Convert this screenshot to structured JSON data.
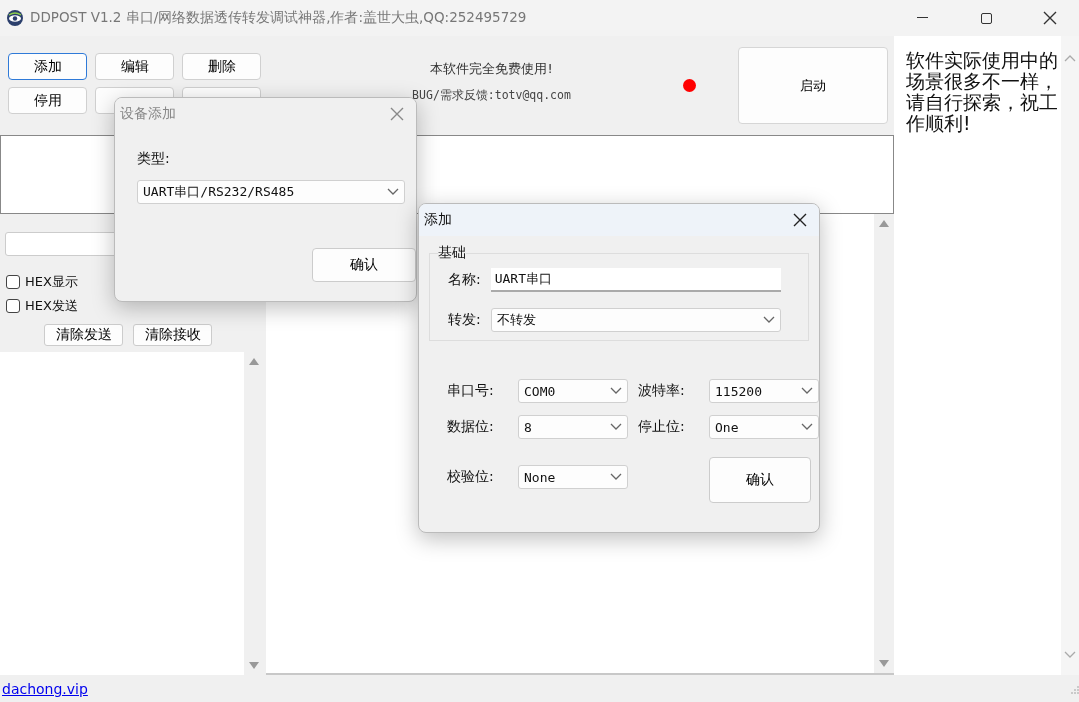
{
  "window": {
    "title": "DDPOST V1.2 串口/网络数据透传转发调试神器,作者:盖世大虫,QQ:252495729"
  },
  "toolbar": {
    "buttons": [
      {
        "label": "添加",
        "selected": true
      },
      {
        "label": "编辑",
        "selected": false
      },
      {
        "label": "删除",
        "selected": false
      },
      {
        "label": "停用",
        "selected": false
      }
    ],
    "notice": "本软件完全免费使用!",
    "feedback": "BUG/需求反馈:totv@qq.com",
    "running": false,
    "start_button": "启动"
  },
  "side_note": "软件实际使用中的场景很多不一样，请自行探索，祝工作顺利!",
  "send_panel": {
    "checkboxes": [
      {
        "label": "HEX显示",
        "checked": false
      },
      {
        "label": "HEX发送",
        "checked": false
      }
    ],
    "buttons": [
      "清除发送",
      "清除接收"
    ]
  },
  "status_bar": {
    "link": "dachong.vip"
  },
  "device_dialog": {
    "title": "设备添加",
    "active": false,
    "type_label": "类型:",
    "type_value": "UART串口/RS232/RS485",
    "confirm": "确认"
  },
  "add_dialog": {
    "title": "添加",
    "active": true,
    "group": "基础",
    "name_label": "名称:",
    "name_value": "UART串口",
    "forward_label": "转发:",
    "forward_value": "不转发",
    "fields": [
      {
        "label": "串口号:",
        "value": "COM0"
      },
      {
        "label": "波特率:",
        "value": "115200"
      },
      {
        "label": "数据位:",
        "value": "8"
      },
      {
        "label": "停止位:",
        "value": "One"
      },
      {
        "label": "校验位:",
        "value": "None"
      }
    ],
    "confirm": "确认"
  }
}
